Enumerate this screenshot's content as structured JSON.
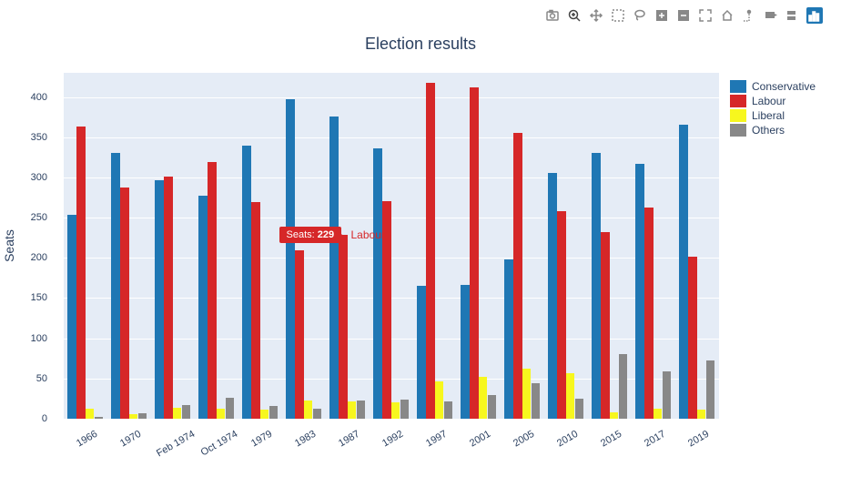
{
  "title": "Election results",
  "ylabel": "Seats",
  "legend_items": [
    {
      "name": "Conservative",
      "color": "#1f77b4"
    },
    {
      "name": "Labour",
      "color": "#d62728"
    },
    {
      "name": "Liberal",
      "color": "#f7f71e"
    },
    {
      "name": "Others",
      "color": "#888888"
    }
  ],
  "tooltip": {
    "prefix": "Seats: ",
    "value": "229",
    "label": "Labour",
    "category_index": 6,
    "series_index": 1
  },
  "chart_data": {
    "type": "bar",
    "title": "Election results",
    "xlabel": "",
    "ylabel": "Seats",
    "ylim": [
      0,
      430
    ],
    "y_ticks": [
      0,
      50,
      100,
      150,
      200,
      250,
      300,
      350,
      400
    ],
    "categories": [
      "1966",
      "1970",
      "Feb 1974",
      "Oct 1974",
      "1979",
      "1983",
      "1987",
      "1992",
      "1997",
      "2001",
      "2005",
      "2010",
      "2015",
      "2017",
      "2019"
    ],
    "series": [
      {
        "name": "Conservative",
        "color": "#1f77b4",
        "values": [
          253,
          330,
          297,
          277,
          339,
          397,
          376,
          336,
          165,
          166,
          198,
          306,
          331,
          317,
          365
        ]
      },
      {
        "name": "Labour",
        "color": "#d62728",
        "values": [
          363,
          288,
          301,
          319,
          269,
          209,
          229,
          271,
          418,
          412,
          355,
          258,
          232,
          262,
          202
        ]
      },
      {
        "name": "Liberal",
        "color": "#f7f71e",
        "values": [
          12,
          6,
          14,
          13,
          11,
          23,
          22,
          20,
          46,
          52,
          62,
          57,
          8,
          12,
          11
        ]
      },
      {
        "name": "Others",
        "color": "#888888",
        "values": [
          2,
          7,
          17,
          26,
          16,
          12,
          23,
          24,
          21,
          29,
          44,
          25,
          80,
          59,
          72
        ]
      }
    ]
  }
}
